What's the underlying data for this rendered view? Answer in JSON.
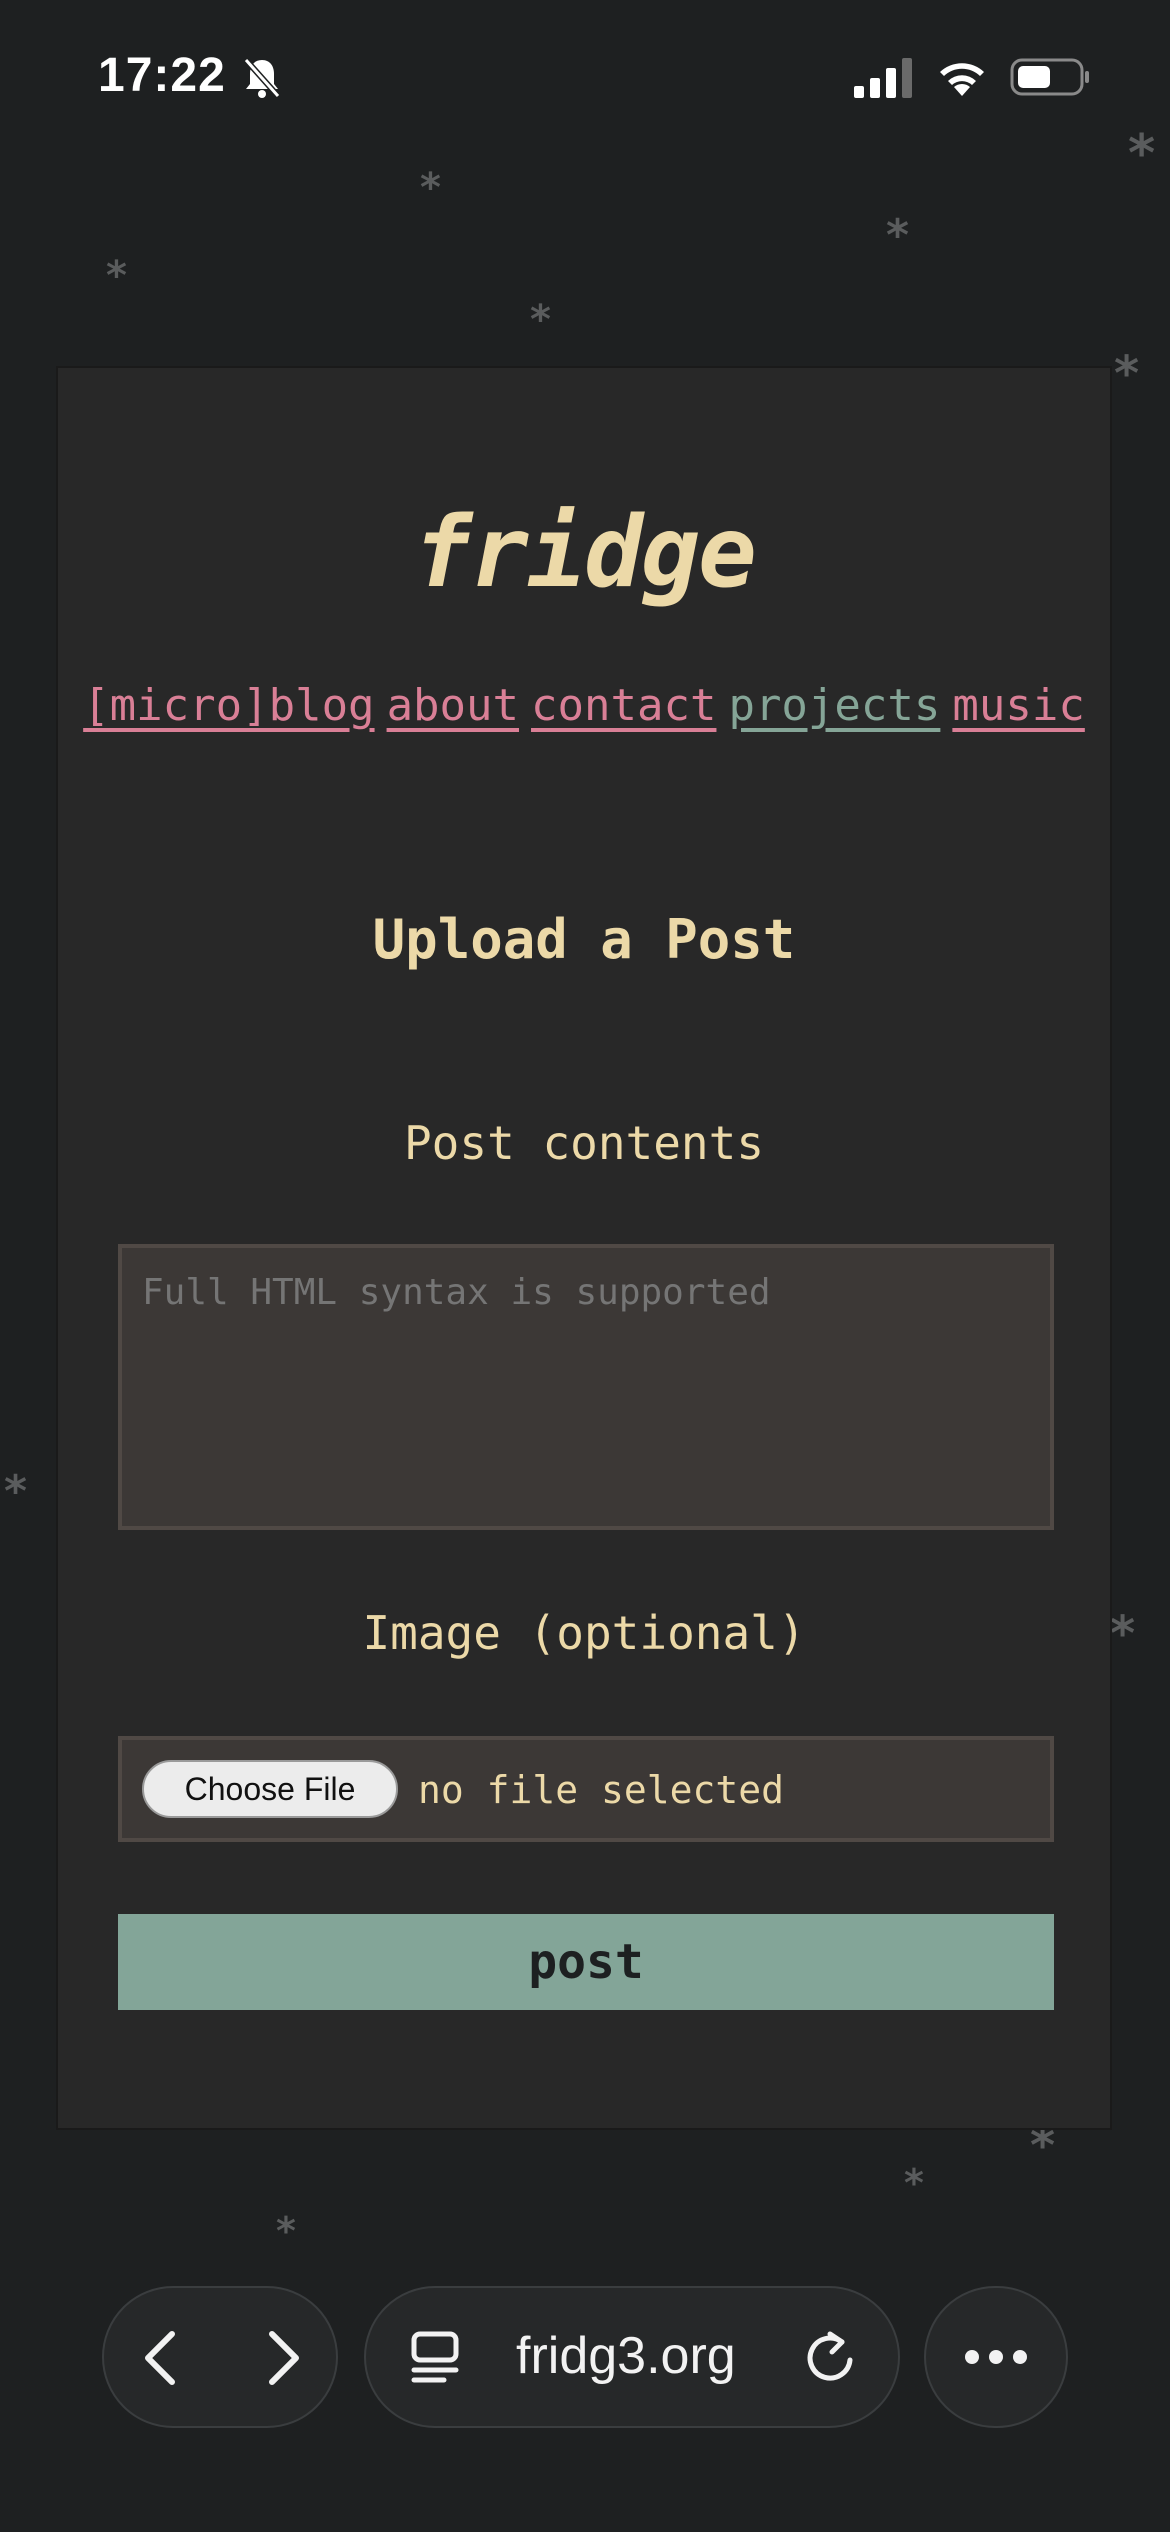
{
  "status_bar": {
    "time": "17:22",
    "icons": [
      "bell-slash-icon",
      "signal-icon",
      "wifi-icon",
      "battery-icon"
    ]
  },
  "site": {
    "title": "fridge",
    "nav": [
      {
        "label": "[micro]blog",
        "color": "#d97f96"
      },
      {
        "label": "about",
        "color": "#d97f96"
      },
      {
        "label": "contact",
        "color": "#d97f96"
      },
      {
        "label": "projects",
        "color": "#85a597"
      },
      {
        "label": "music",
        "color": "#d97f96"
      }
    ]
  },
  "form": {
    "heading": "Upload a Post",
    "contents_label": "Post contents",
    "contents_placeholder": "Full HTML syntax is supported",
    "contents_value": "",
    "image_label": "Image (optional)",
    "choose_file_label": "Choose File",
    "file_status": "no file selected",
    "submit_label": "post"
  },
  "browser": {
    "url": "fridg3.org",
    "icons": [
      "back-icon",
      "forward-icon",
      "tabs-icon",
      "reload-icon",
      "more-icon"
    ]
  },
  "colors": {
    "background": "#1e2021",
    "card": "#282828",
    "accent_cream": "#ecd9a8",
    "accent_pink": "#d97f96",
    "accent_green": "#83a598"
  }
}
